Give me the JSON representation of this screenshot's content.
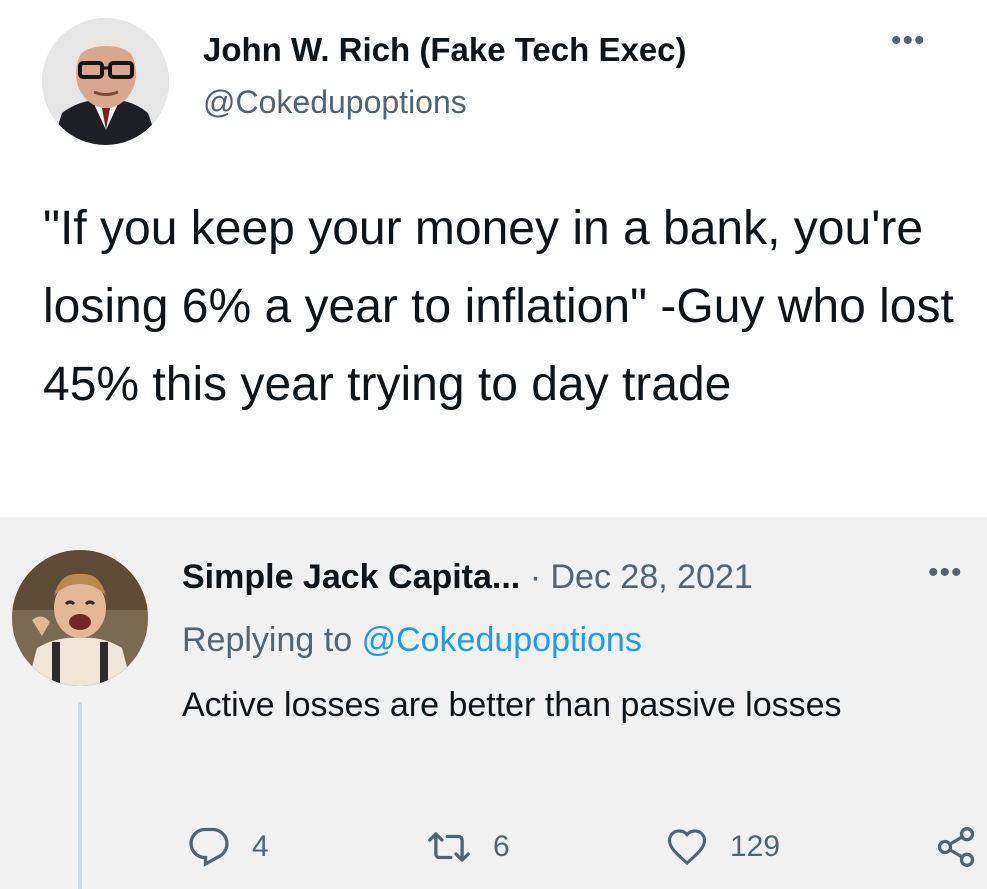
{
  "main_tweet": {
    "display_name": "John W. Rich (Fake Tech Exec)",
    "handle": "@Cokedupoptions",
    "text": "\"If you keep your money in a bank, you're losing 6% a year to inflation\" -Guy who lost 45% this year trying to day trade",
    "more_icon": "more-horizontal-icon"
  },
  "reply": {
    "display_name": "Simple Jack Capita...",
    "separator": "·",
    "date": "Dec 28, 2021",
    "replying_label": "Replying to",
    "replying_handle": "@Cokedupoptions",
    "text": "Active losses are better than passive losses",
    "more_icon": "more-horizontal-icon",
    "actions": {
      "reply_count": "4",
      "retweet_count": "6",
      "like_count": "129"
    }
  },
  "colors": {
    "text_primary": "#0f1419",
    "text_secondary": "#536471",
    "link": "#1d9bf0",
    "reply_background": "#f1f1f1",
    "thread_line": "#cfd9de"
  }
}
